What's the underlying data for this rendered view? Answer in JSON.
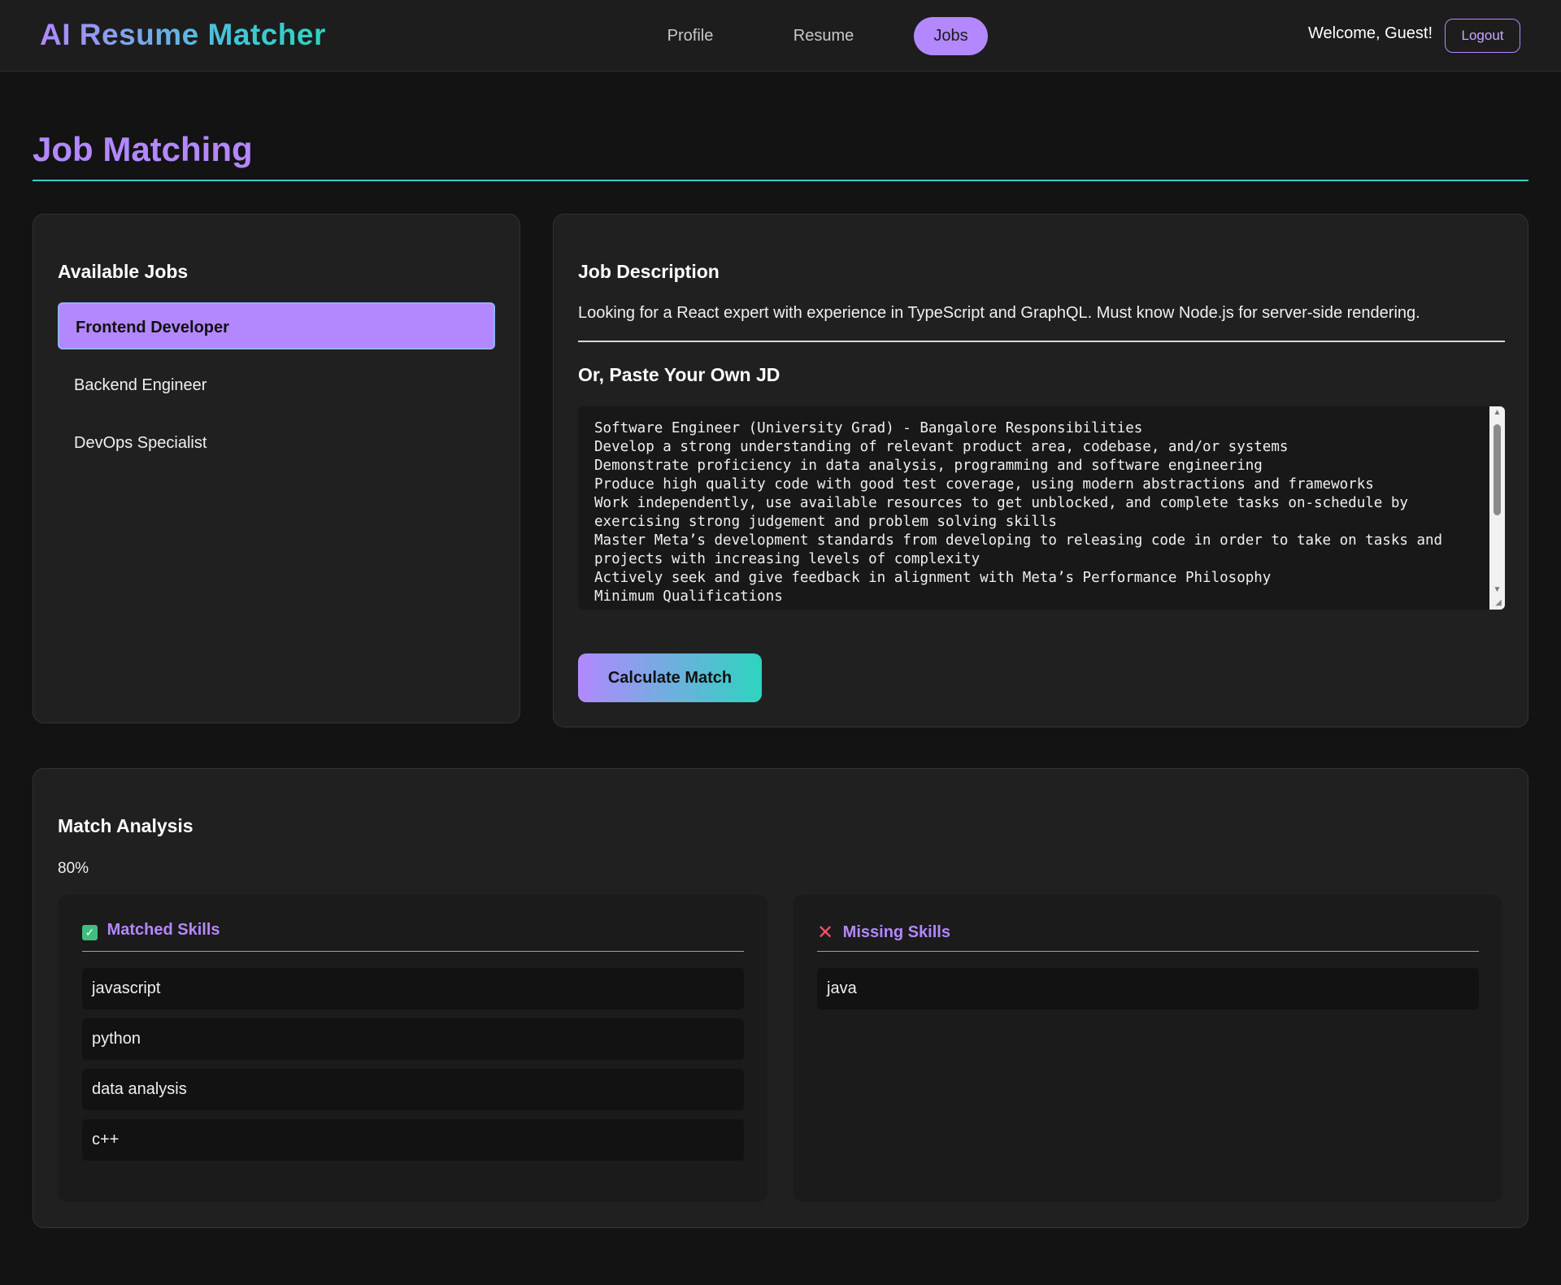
{
  "header": {
    "brand": "AI Resume Matcher",
    "nav": [
      {
        "label": "Profile"
      },
      {
        "label": "Resume"
      },
      {
        "label": "Jobs",
        "active": true
      }
    ],
    "welcome": "Welcome, Guest!",
    "logout_label": "Logout"
  },
  "page": {
    "title": "Job Matching"
  },
  "jobs": {
    "heading": "Available Jobs",
    "items": [
      {
        "label": "Frontend Developer",
        "active": true
      },
      {
        "label": "Backend Engineer"
      },
      {
        "label": "DevOps Specialist"
      }
    ]
  },
  "description": {
    "heading": "Job Description",
    "text": "Looking for a React expert with experience in TypeScript and GraphQL. Must know Node.js for server-side rendering.",
    "paste_heading": "Or, Paste Your Own JD",
    "pasted_jd": "Software Engineer (University Grad) - Bangalore Responsibilities\nDevelop a strong understanding of relevant product area, codebase, and/or systems\nDemonstrate proficiency in data analysis, programming and software engineering\nProduce high quality code with good test coverage, using modern abstractions and frameworks\nWork independently, use available resources to get unblocked, and complete tasks on-schedule by exercising strong judgement and problem solving skills\nMaster Meta’s development standards from developing to releasing code in order to take on tasks and projects with increasing levels of complexity\nActively seek and give feedback in alignment with Meta’s Performance Philosophy\nMinimum Qualifications",
    "calculate_label": "Calculate Match"
  },
  "match": {
    "heading": "Match Analysis",
    "score": "80%",
    "matched": {
      "heading": "Matched Skills",
      "icon": "check-box-icon",
      "skills": [
        "javascript",
        "python",
        "data analysis",
        "c++"
      ]
    },
    "missing": {
      "heading": "Missing Skills",
      "icon": "x-icon",
      "skills": [
        "java"
      ]
    }
  },
  "colors": {
    "accent_purple": "#b388ff",
    "accent_teal": "#2dd4bf",
    "background": "#131313",
    "card": "#202020"
  }
}
